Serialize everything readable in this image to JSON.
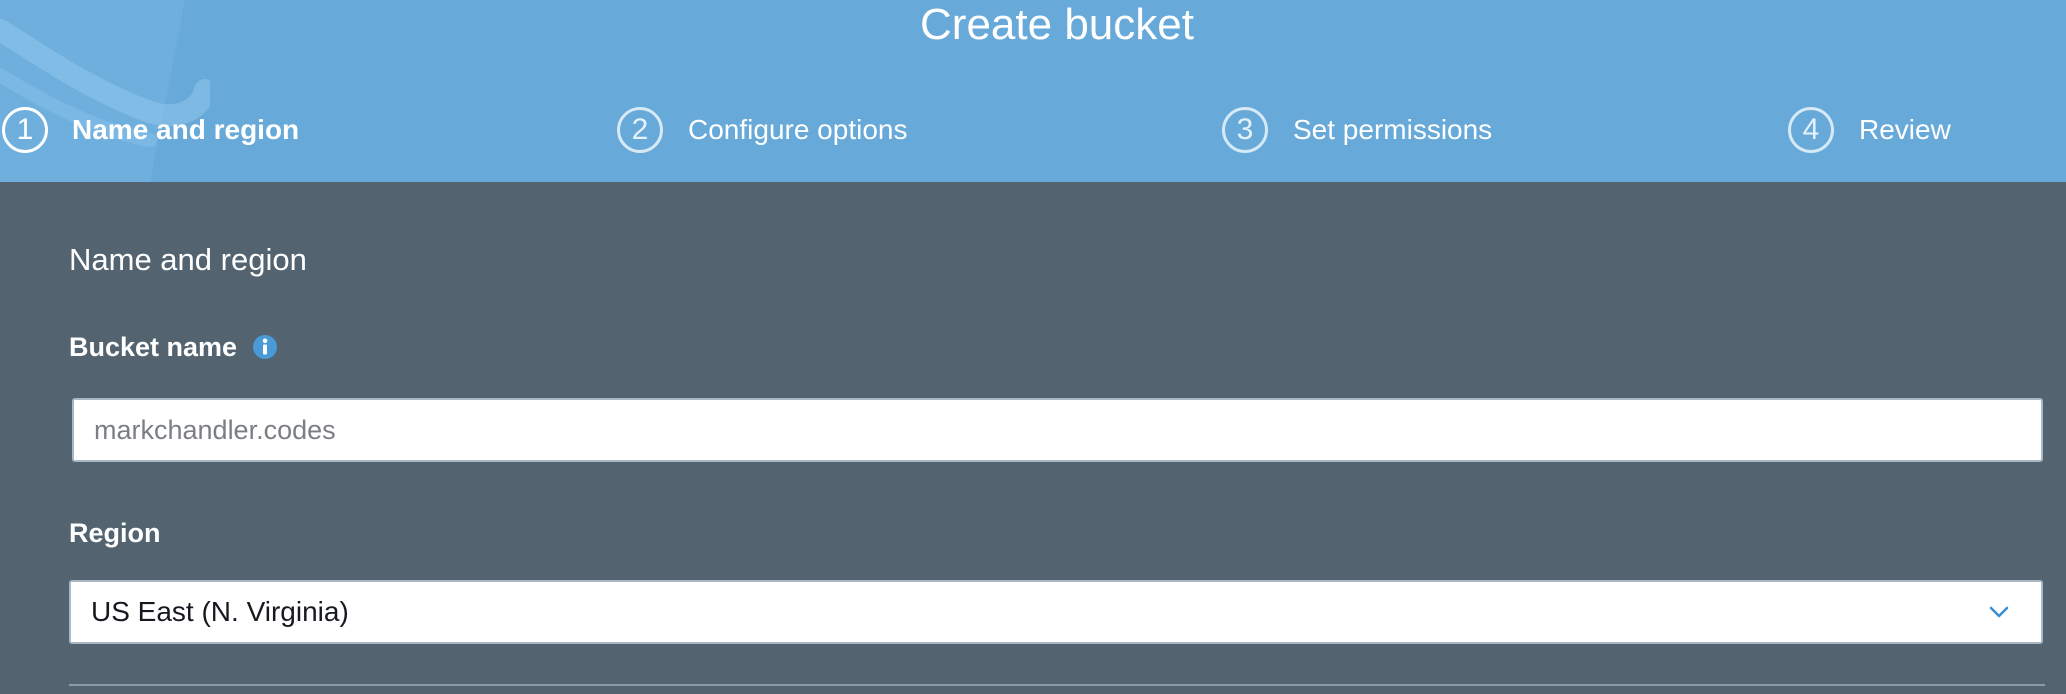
{
  "header": {
    "title": "Create bucket",
    "steps": [
      {
        "number": "1",
        "label": "Name and region",
        "active": true
      },
      {
        "number": "2",
        "label": "Configure options",
        "active": false
      },
      {
        "number": "3",
        "label": "Set permissions",
        "active": false
      },
      {
        "number": "4",
        "label": "Review",
        "active": false
      }
    ]
  },
  "form": {
    "section_title": "Name and region",
    "bucket_name": {
      "label": "Bucket name",
      "info_icon": "info-icon",
      "placeholder": "markchandler.codes",
      "value": ""
    },
    "region": {
      "label": "Region",
      "selected": "US East (N. Virginia)",
      "icon": "chevron-down-icon"
    }
  },
  "colors": {
    "header_bg": "#67a9d9",
    "body_bg": "#536470",
    "info_accent": "#4a9ad8"
  }
}
